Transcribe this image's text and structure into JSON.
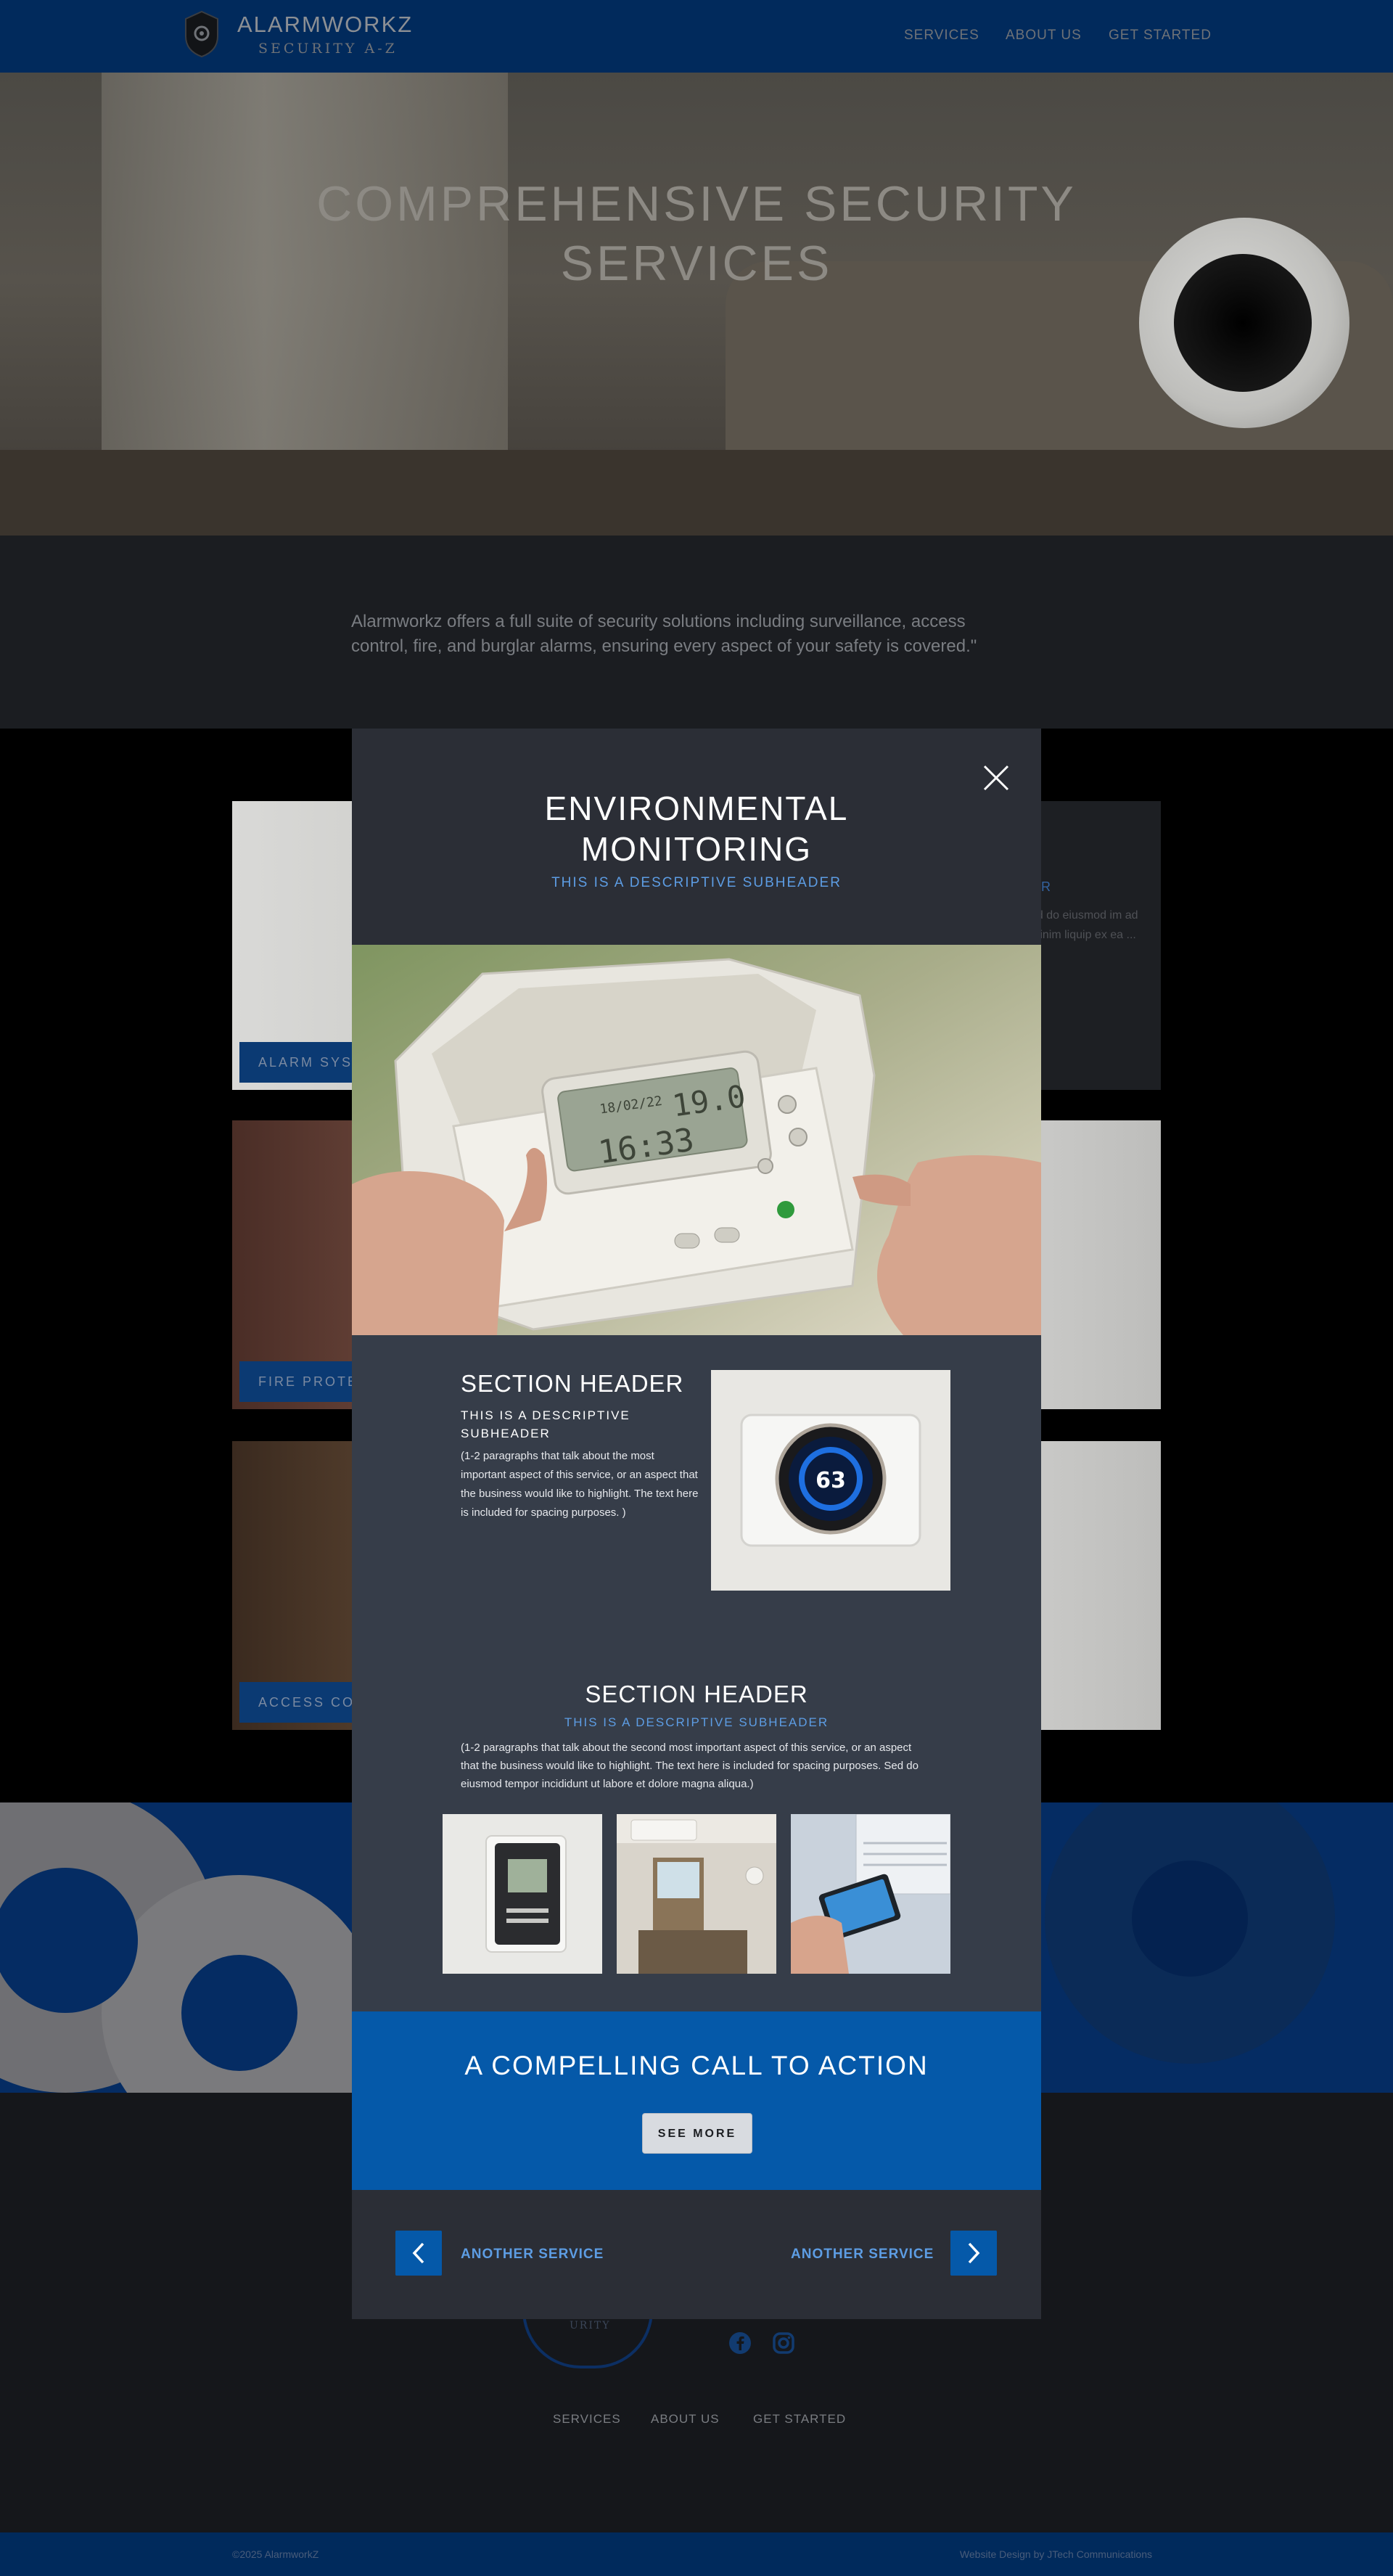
{
  "header": {
    "brand_name": "ALARMWORKZ",
    "brand_tagline": "SECURITY A-Z",
    "nav": [
      "SERVICES",
      "ABOUT US",
      "GET STARTED"
    ]
  },
  "hero": {
    "title": "COMPREHENSIVE SECURITY SERVICES"
  },
  "intro": {
    "text": "Alarmworkz offers a full suite of security solutions including surveillance, access control, fire, and burglar alarms, ensuring every aspect of your safety is covered.\""
  },
  "services": {
    "cards": [
      {
        "label": "ALARM SYSTEMS",
        "side_title": "UR",
        "side_text": "ed do eiusmod im ad minim liquip ex ea ..."
      },
      {
        "label": "FIRE PROTECTION"
      },
      {
        "label": "ACCESS CONTROL"
      }
    ]
  },
  "modal": {
    "title_line1": "ENVIRONMENTAL",
    "title_line2": "MONITORING",
    "subheader": "THIS IS A DESCRIPTIVE SUBHEADER",
    "section1": {
      "header": "SECTION HEADER",
      "subheader": "THIS IS A DESCRIPTIVE SUBHEADER",
      "body": "(1-2 paragraphs that talk about the most important aspect of this service, or an aspect that the business would like to highlight. The text here is included for spacing purposes. )",
      "thermostat_value": "63"
    },
    "section2": {
      "header": "SECTION HEADER",
      "subheader": "THIS IS A DESCRIPTIVE SUBHEADER",
      "body": "(1-2 paragraphs that talk about the second most important aspect of this service, or an aspect that the business would like to highlight. The text here is included for spacing purposes. Sed do eiusmod tempor incididunt ut labore et dolore magna aliqua.)"
    },
    "cta": {
      "title": "A COMPELLING CALL TO ACTION",
      "button": "SEE MORE"
    },
    "nav": {
      "prev_label": "ANOTHER SERVICE",
      "next_label": "ANOTHER SERVICE"
    },
    "device": {
      "date": "18/02/22",
      "time": "16:33",
      "temp": "19.0"
    }
  },
  "footer": {
    "shield_text": "URITY",
    "nav": [
      "SERVICES",
      "ABOUT US",
      "GET STARTED"
    ],
    "copyright": "©2025 AlarmworkZ",
    "credit": "Website Design by JTech Communications"
  },
  "colors": {
    "header_bg": "#012a5c",
    "accent_blue": "#0559a9",
    "link_blue": "#5d9de4",
    "modal_bg": "#363d49"
  }
}
